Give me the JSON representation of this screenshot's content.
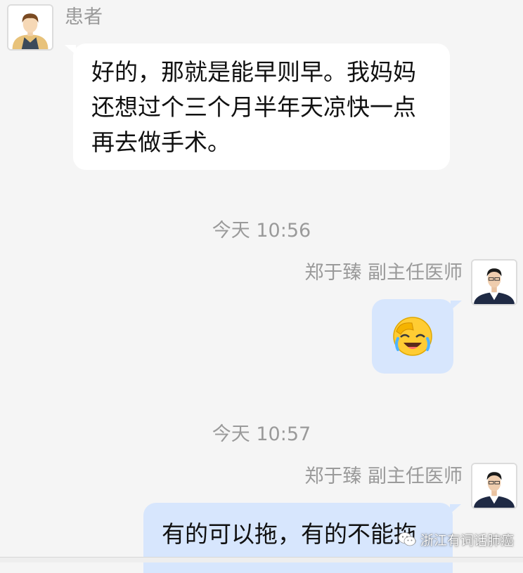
{
  "patient": {
    "name": "患者",
    "message": "好的，那就是能早则早。我妈妈还想过个三个月半年天凉快一点再去做手术。"
  },
  "timestamps": [
    "今天 10:56",
    "今天 10:57"
  ],
  "doctor": {
    "name": "郑于臻 副主任医师",
    "messages": [
      {
        "type": "emoji",
        "emoji": "😭",
        "emoji_name": "face-palm-cry-icon"
      },
      {
        "type": "text",
        "text": "有的可以拖，有的不能拖"
      }
    ]
  },
  "watermark": {
    "text": "浙江有词话肺癌",
    "icon": "wechat-icon"
  },
  "colors": {
    "background": "#f5f5f5",
    "patient_bubble": "#ffffff",
    "doctor_bubble": "#d7e6fd",
    "meta_text": "#9a9a9a"
  }
}
